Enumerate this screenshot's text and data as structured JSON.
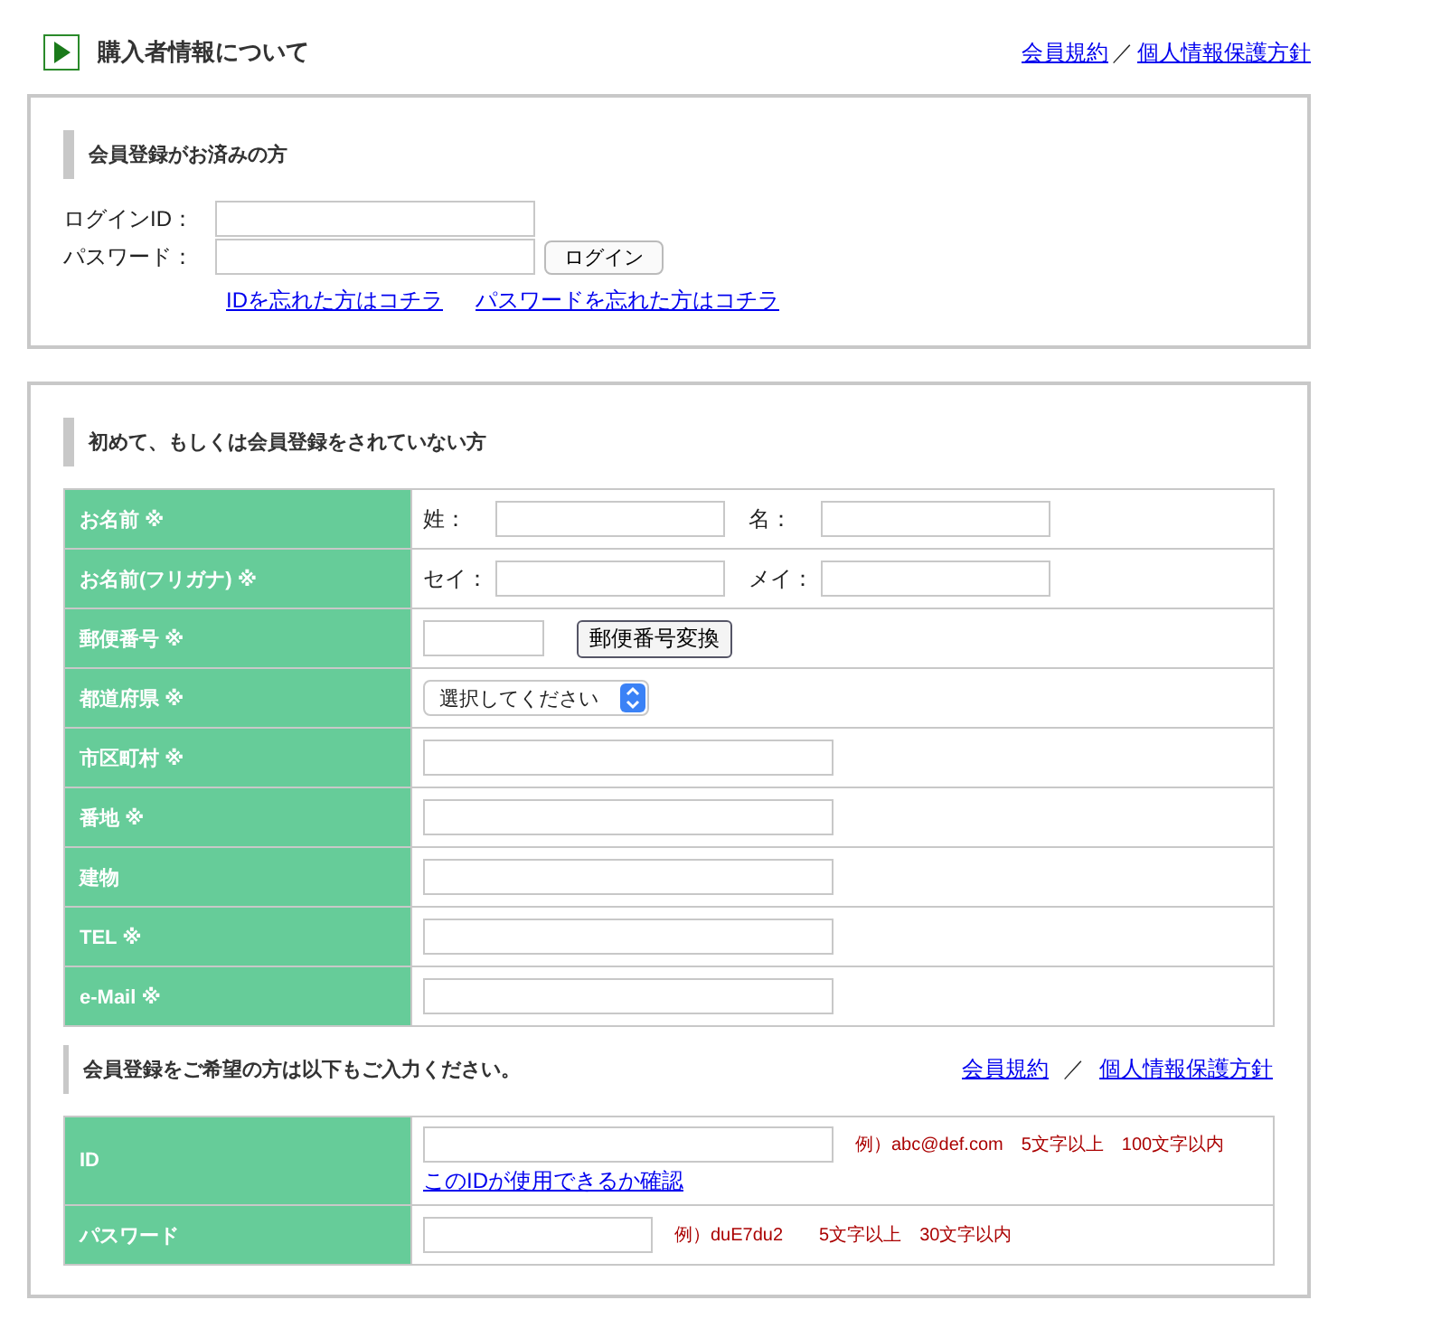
{
  "header": {
    "title": "購入者情報について",
    "links": [
      "会員規約",
      "個人情報保護方針"
    ],
    "separator": "／"
  },
  "login": {
    "heading": "会員登録がお済みの方",
    "fields": [
      {
        "label": "ログインID："
      },
      {
        "label": "パスワード："
      }
    ],
    "button": "ログイン",
    "links": [
      "IDを忘れた方はコチラ",
      "パスワードを忘れた方はコチラ"
    ]
  },
  "guest": {
    "heading": "初めて、もしくは会員登録をされていない方",
    "rows": [
      {
        "label": "お名前 ※",
        "kind": "pair",
        "parts": [
          "姓：",
          "名："
        ]
      },
      {
        "label": "お名前(フリガナ) ※",
        "kind": "pair",
        "parts": [
          "セイ：",
          "メイ："
        ]
      },
      {
        "label": "郵便番号 ※",
        "kind": "zip",
        "button": "郵便番号変換"
      },
      {
        "label": "都道府県 ※",
        "kind": "select",
        "value": "選択してください"
      },
      {
        "label": "市区町村 ※",
        "kind": "text"
      },
      {
        "label": "番地 ※",
        "kind": "text"
      },
      {
        "label": "建物",
        "kind": "text"
      },
      {
        "label": "TEL ※",
        "kind": "text"
      },
      {
        "label": "e-Mail ※",
        "kind": "text"
      }
    ]
  },
  "member": {
    "heading": "会員登録をご希望の方は以下もご入力ください。",
    "links": [
      "会員規約",
      "個人情報保護方針"
    ],
    "separator": "／",
    "rows": [
      {
        "label": "ID",
        "kind": "wide",
        "hint": "例）abc@def.com　5文字以上　100文字以内",
        "link": "このIDが使用できるか確認"
      },
      {
        "label": "パスワード",
        "kind": "short",
        "hint": "例）duE7du2　　5文字以上　30文字以内"
      }
    ]
  }
}
